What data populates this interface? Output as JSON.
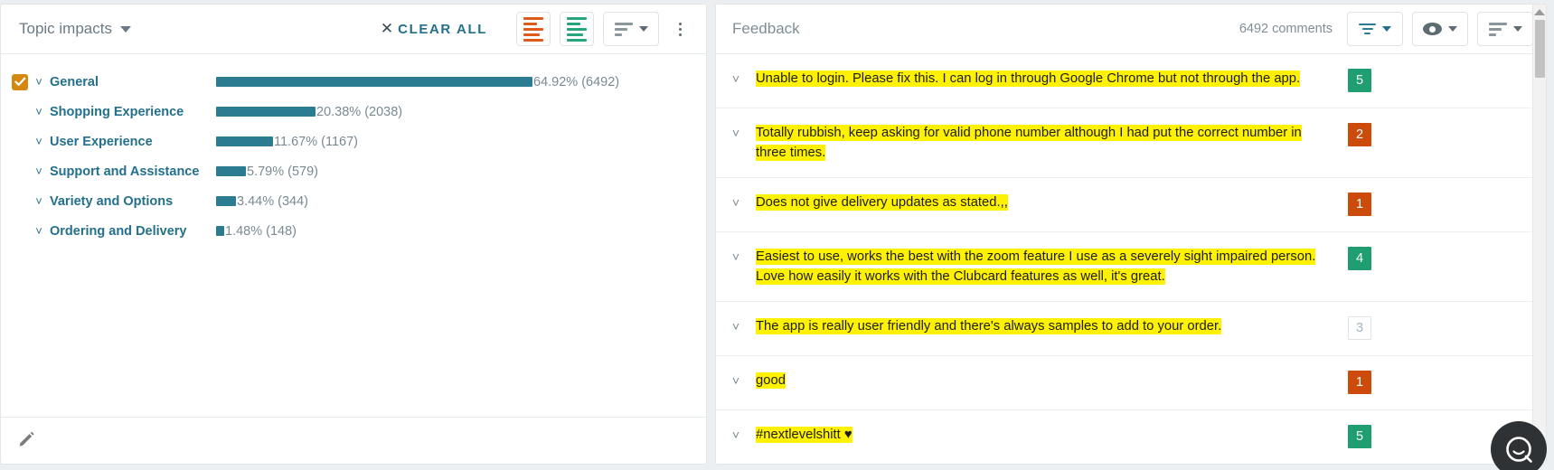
{
  "left_panel": {
    "toolbar": {
      "topic_selector_label": "Topic impacts",
      "clear_all_label": "CLEAR ALL",
      "clear_all_x": "✕",
      "negative_icon_name": "negative-bars-icon",
      "positive_icon_name": "positive-bars-icon",
      "sort_icon_name": "sort-descending-icon",
      "more_icon_name": "kebab-menu-icon",
      "accent_orange": "#de5a19",
      "accent_green": "#27a578",
      "accent_teal": "#23708c"
    },
    "chart_data": {
      "type": "bar",
      "title": "Topic impacts",
      "orientation": "horizontal",
      "xlabel": "",
      "ylabel": "",
      "bar_color": "#2b7b91",
      "categories": [
        "General",
        "Shopping Experience",
        "User Experience",
        "Support and Assistance",
        "Variety and Options",
        "Ordering and Delivery"
      ],
      "values": [
        64.92,
        20.38,
        11.67,
        5.79,
        3.44,
        1.48
      ],
      "counts": [
        6492,
        2038,
        1167,
        579,
        344,
        148
      ],
      "labels": [
        "64.92% (6492)",
        "20.38% (2038)",
        "11.67% (1167)",
        "5.79% (579)",
        "3.44% (344)",
        "1.48% (148)"
      ],
      "selected": [
        true,
        false,
        false,
        false,
        false,
        false
      ],
      "xlim": [
        0,
        70
      ],
      "grid": false,
      "legend": "none"
    },
    "footer": {
      "edit_icon_name": "pencil-icon"
    }
  },
  "right_panel": {
    "toolbar": {
      "title": "Feedback",
      "comment_count_label": "6492 comments",
      "filter_icon_name": "filter-funnel-icon",
      "visibility_icon_name": "eye-icon",
      "sort_icon_name": "sort-descending-icon"
    },
    "comments": [
      {
        "text": "Unable to login. Please fix this. I can log in through Google Chrome but not through the app.",
        "score": "5",
        "sentiment": "pos",
        "highlighted": true
      },
      {
        "text": "Totally rubbish, keep asking for valid phone number although I had put the correct number in three times.",
        "score": "2",
        "sentiment": "neg",
        "highlighted": true
      },
      {
        "text": "Does not give delivery updates as stated.,,",
        "score": "1",
        "sentiment": "neg",
        "highlighted": true
      },
      {
        "text": "Easiest to use, works the best with the zoom feature I use as a severely sight impaired person. Love how easily it works with the Clubcard features as well, it's great.",
        "score": "4",
        "sentiment": "pos",
        "highlighted": true
      },
      {
        "text": "The app is really user friendly and there's always samples to add to your order.",
        "score": "3",
        "sentiment": "neu",
        "highlighted": true
      },
      {
        "text": "good",
        "score": "1",
        "sentiment": "neg",
        "highlighted": true
      },
      {
        "text": "#nextlevelshitt ♥",
        "score": "5",
        "sentiment": "pos",
        "highlighted": true
      }
    ],
    "scrollbar": {
      "up_arrow_name": "scroll-up-arrow"
    }
  },
  "chat_widget": {
    "icon_name": "chat-bubble-icon"
  }
}
